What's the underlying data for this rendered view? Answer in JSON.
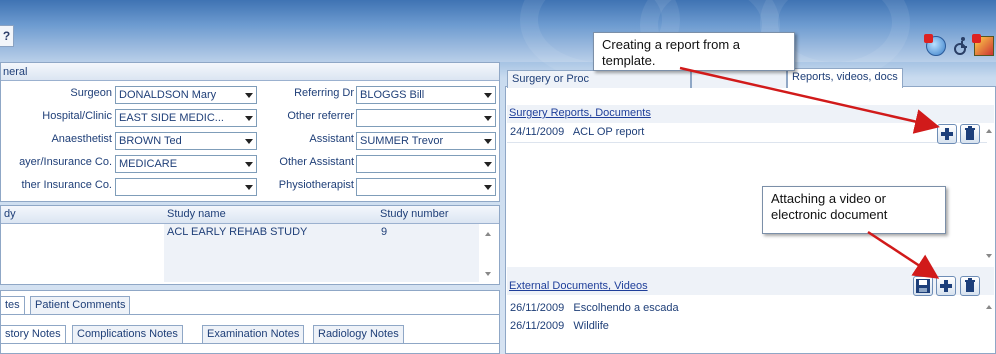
{
  "top_button": "?",
  "general": {
    "header": "neral",
    "fields": [
      {
        "label": "Surgeon",
        "value": "DONALDSON Mary"
      },
      {
        "label": "Hospital/Clinic",
        "value": "EAST SIDE MEDIC..."
      },
      {
        "label": "Anaesthetist",
        "value": "BROWN Ted"
      },
      {
        "label": "ayer/Insurance Co.",
        "value": "MEDICARE"
      },
      {
        "label": "ther Insurance Co.",
        "value": ""
      }
    ],
    "fields_right": [
      {
        "label": "Referring Dr",
        "value": "BLOGGS Bill"
      },
      {
        "label": "Other referrer",
        "value": ""
      },
      {
        "label": "Assistant",
        "value": "SUMMER Trevor"
      },
      {
        "label": "Other Assistant",
        "value": ""
      },
      {
        "label": "Physiotherapist",
        "value": ""
      }
    ]
  },
  "study": {
    "col_study": "dy",
    "col_name": "Study name",
    "col_number": "Study number",
    "rows": [
      {
        "name": "ACL EARLY REHAB STUDY",
        "number": "9"
      }
    ]
  },
  "notes_tabs": [
    "tes",
    "Patient Comments"
  ],
  "notes_subtabs": [
    "story Notes",
    "Complications Notes",
    "Examination Notes",
    "Radiology Notes"
  ],
  "right_tabs": [
    "Surgery or Proc",
    "Reports, videos, docs"
  ],
  "reports": {
    "title": "Surgery Reports, Documents",
    "rows": [
      {
        "date": "24/11/2009",
        "name": "ACL OP report"
      }
    ]
  },
  "external": {
    "title": "External Documents, Videos",
    "rows": [
      {
        "date": "26/11/2009",
        "name": "Escolhendo a escada"
      },
      {
        "date": "26/11/2009",
        "name": "Wildlife"
      }
    ]
  },
  "callouts": {
    "template": "Creating a report from a template.",
    "attach": "Attaching a video or electronic document"
  },
  "colors": {
    "arrow": "#d11a1a",
    "label": "#1f3f78"
  }
}
